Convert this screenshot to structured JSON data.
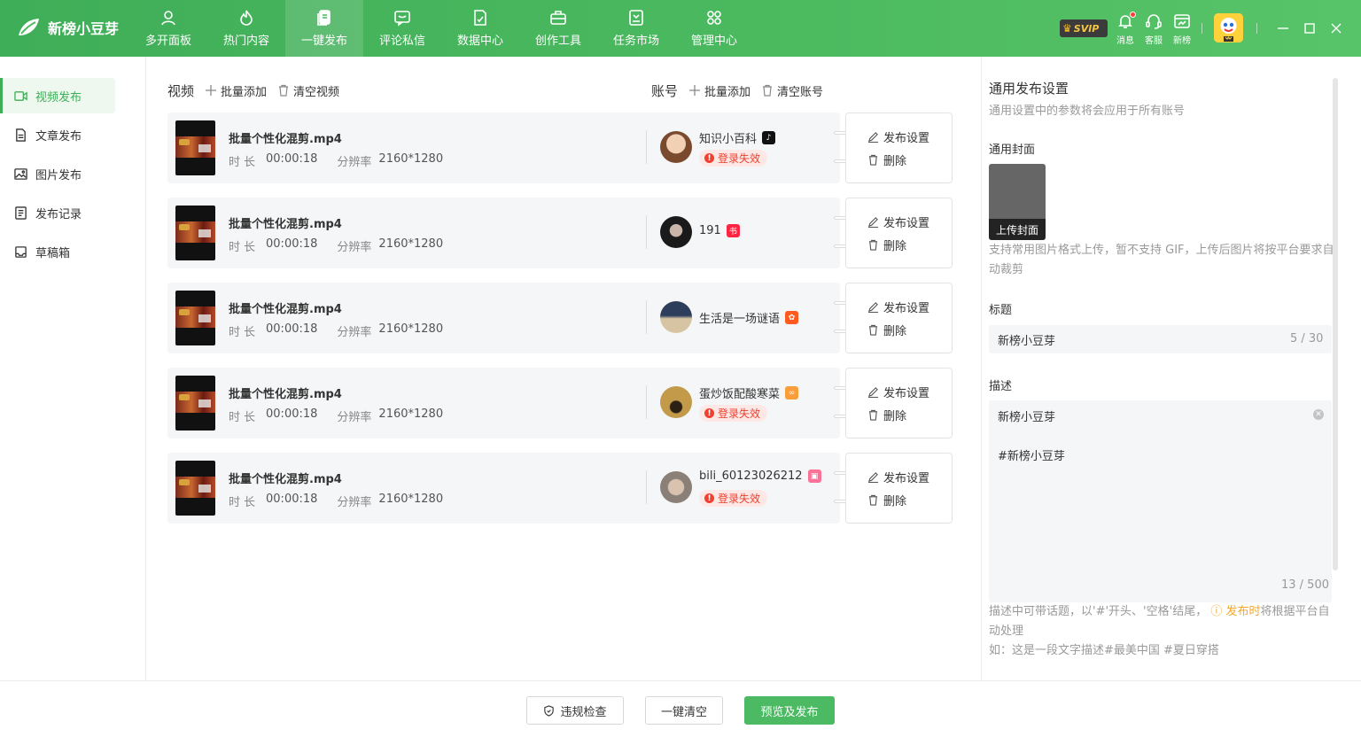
{
  "app": {
    "name": "新榜小豆芽"
  },
  "nav": [
    {
      "label": "多开面板",
      "icon": "user-icon"
    },
    {
      "label": "热门内容",
      "icon": "fire-icon"
    },
    {
      "label": "一键发布",
      "icon": "publish-icon"
    },
    {
      "label": "评论私信",
      "icon": "message-icon"
    },
    {
      "label": "数据中心",
      "icon": "data-icon"
    },
    {
      "label": "创作工具",
      "icon": "toolbox-icon"
    },
    {
      "label": "任务市场",
      "icon": "task-icon"
    },
    {
      "label": "管理中心",
      "icon": "grid-icon"
    }
  ],
  "nav_active": "一键发布",
  "top_tools": {
    "svip": "SVIP",
    "message": "消息",
    "service": "客服",
    "rank": "新榜"
  },
  "sidebar": [
    {
      "label": "视频发布",
      "icon": "video-icon"
    },
    {
      "label": "文章发布",
      "icon": "article-icon"
    },
    {
      "label": "图片发布",
      "icon": "image-icon"
    },
    {
      "label": "发布记录",
      "icon": "record-icon"
    },
    {
      "label": "草稿箱",
      "icon": "draft-icon"
    }
  ],
  "videos_header": {
    "title": "视频",
    "batch_add": "批量添加",
    "clear": "清空视频"
  },
  "accounts_header": {
    "title": "账号",
    "batch_add": "批量添加",
    "clear": "清空账号"
  },
  "meta_labels": {
    "duration": "时长",
    "resolution": "分辨率"
  },
  "row_actions": {
    "settings": "发布设置",
    "delete": "删除"
  },
  "rows": [
    {
      "file": "批量个性化混剪.mp4",
      "duration": "00:00:18",
      "resolution": "2160*1280",
      "account": "知识小百科",
      "platform": "douyin",
      "status": "登录失效"
    },
    {
      "file": "批量个性化混剪.mp4",
      "duration": "00:00:18",
      "resolution": "2160*1280",
      "account": "191",
      "platform": "xiaohongshu",
      "status": ""
    },
    {
      "file": "批量个性化混剪.mp4",
      "duration": "00:00:18",
      "resolution": "2160*1280",
      "account": "生活是一场谜语",
      "platform": "kuaishou",
      "status": ""
    },
    {
      "file": "批量个性化混剪.mp4",
      "duration": "00:00:18",
      "resolution": "2160*1280",
      "account": "蛋炒饭配酸寒菜",
      "platform": "shipinhao",
      "status": "登录失效"
    },
    {
      "file": "批量个性化混剪.mp4",
      "duration": "00:00:18",
      "resolution": "2160*1280",
      "account": "bili_60123026212",
      "platform": "bilibili",
      "status": "登录失效"
    }
  ],
  "settings": {
    "title": "通用发布设置",
    "subtitle": "通用设置中的参数将会应用于所有账号",
    "cover_label": "通用封面",
    "cover_button": "上传封面",
    "cover_tip": "支持常用图片格式上传，暂不支持 GIF，上传后图片将按平台要求自动裁剪",
    "title_label": "标题",
    "title_value": "新榜小豆芽",
    "title_count": "5 / 30",
    "desc_label": "描述",
    "desc_line1": "新榜小豆芽",
    "desc_line2": "#新榜小豆芽",
    "desc_count": "13 / 500",
    "desc_tip_a": "描述中可带话题，以'#'开头、'空格'结尾，",
    "desc_tip_warn": "发布时",
    "desc_tip_b": "将根据平台自动处理",
    "desc_example": "如：这是一段文字描述#最美中国 #夏日穿搭"
  },
  "footer": {
    "check": "违规检查",
    "clear_all": "一键清空",
    "publish": "预览及发布"
  },
  "colors": {
    "brand": "#4cb963",
    "error": "#f0402f",
    "warn": "#f5a623"
  }
}
